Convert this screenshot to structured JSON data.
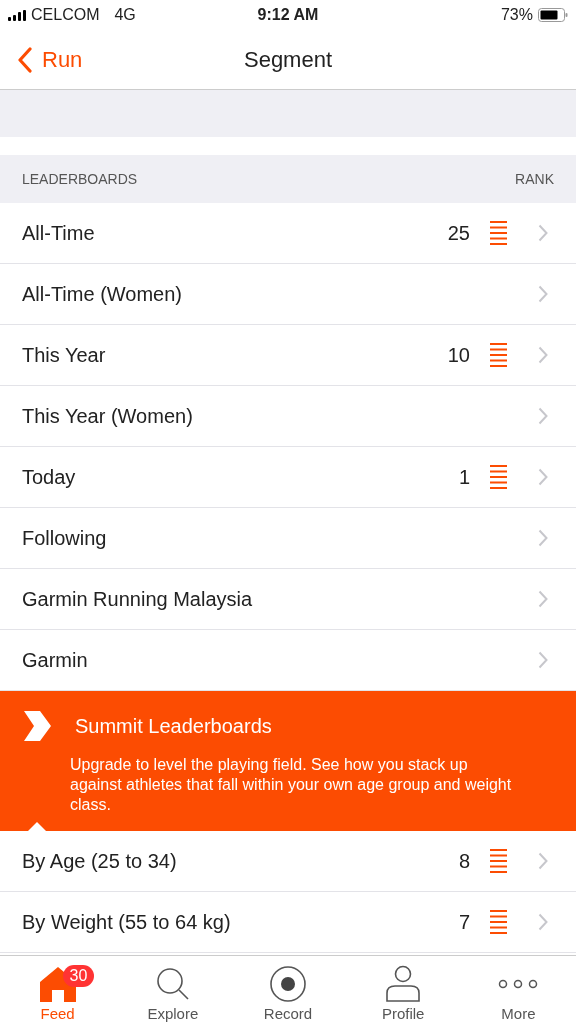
{
  "status_bar": {
    "carrier": "CELCOM",
    "network": "4G",
    "time": "9:12 AM",
    "battery": "73%"
  },
  "nav": {
    "back": "Run",
    "title": "Segment"
  },
  "leaderboards": {
    "header": "LEADERBOARDS",
    "rank_header": "RANK",
    "rows": [
      {
        "label": "All-Time",
        "rank": "25"
      },
      {
        "label": "All-Time (Women)"
      },
      {
        "label": "This Year",
        "rank": "10"
      },
      {
        "label": "This Year (Women)"
      },
      {
        "label": "Today",
        "rank": "1"
      },
      {
        "label": "Following"
      },
      {
        "label": "Garmin Running Malaysia"
      },
      {
        "label": "Garmin"
      }
    ]
  },
  "summit": {
    "title": "Summit Leaderboards",
    "text": "Upgrade to level the playing field. See how you stack up against athletes that fall within your own age group and weight class.",
    "rows": [
      {
        "label": "By Age (25 to 34)",
        "rank": "8"
      },
      {
        "label": "By Weight (55 to 64 kg)",
        "rank": "7"
      }
    ]
  },
  "tabs": [
    {
      "label": "Feed",
      "kind": "home",
      "selected": true,
      "badge": "30"
    },
    {
      "label": "Explore",
      "kind": "search",
      "selected": false
    },
    {
      "label": "Record",
      "kind": "record",
      "selected": false
    },
    {
      "label": "Profile",
      "kind": "profile",
      "selected": false
    },
    {
      "label": "More",
      "kind": "more",
      "selected": false
    }
  ]
}
